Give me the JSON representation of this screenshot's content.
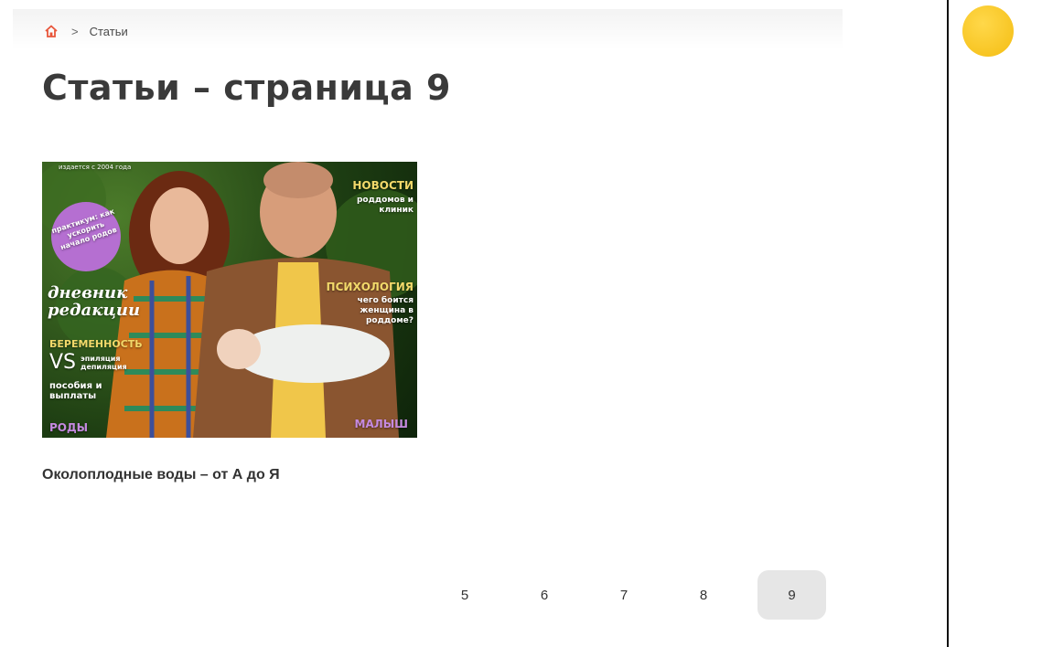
{
  "breadcrumb": {
    "home_icon": "home-icon",
    "separator": ">",
    "current": "Статьи"
  },
  "page_title": "Статьи – страница 9",
  "articles": [
    {
      "title": "Околоплодные воды – от А до Я",
      "cover": {
        "top_label": "издается с 2004 года",
        "news": "НОВОСТИ",
        "news_sub": "роддомов и клиник",
        "sticker": "практикум: как ускорить начало родов",
        "diary": "дневник редакции",
        "psychology": "ПСИХОЛОГИЯ",
        "psychology_sub": "чего боится женщина в роддоме?",
        "pregnancy": "БЕРЕМЕННОСТЬ",
        "vs": "VS",
        "vs_sub": "эпиляция депиляция",
        "benefits": "пособия и выплаты",
        "births": "РОДЫ",
        "baby": "МАЛЫШ"
      }
    }
  ],
  "pagination": {
    "pages": [
      "5",
      "6",
      "7",
      "8",
      "9"
    ],
    "active": "9"
  },
  "colors": {
    "home_icon": "#e8553a",
    "active_page_bg": "#e6e6e6",
    "side_dot": "#f7c21a"
  }
}
